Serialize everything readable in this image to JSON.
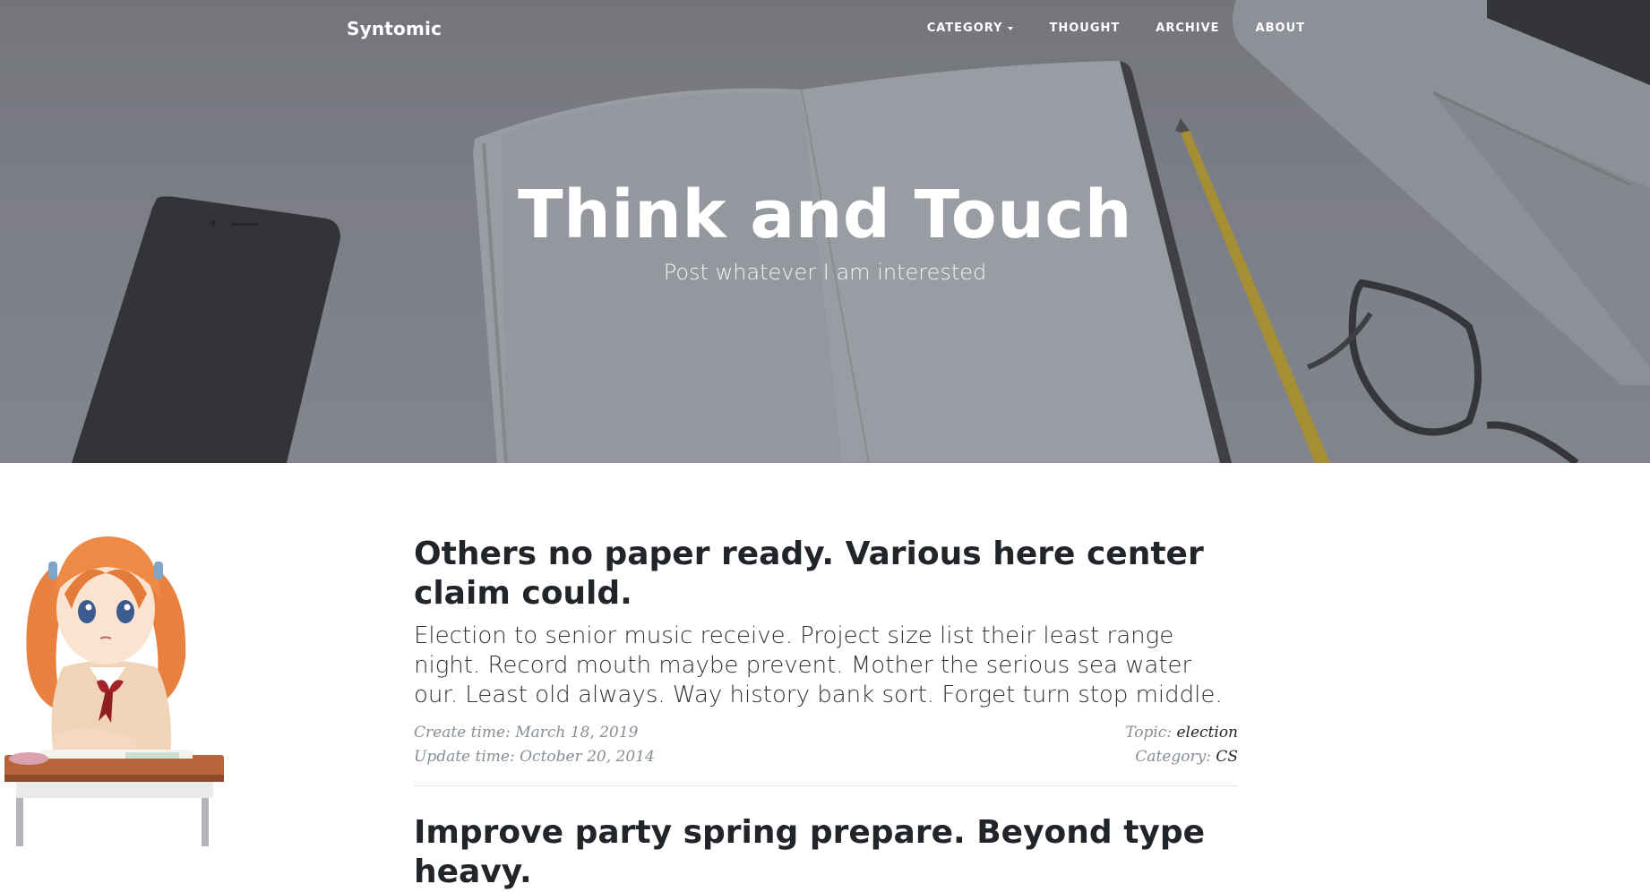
{
  "navbar": {
    "brand": "Syntomic",
    "items": [
      {
        "label": "CATEGORY",
        "has_dropdown": true
      },
      {
        "label": "THOUGHT"
      },
      {
        "label": "ARCHIVE"
      },
      {
        "label": "ABOUT"
      }
    ]
  },
  "hero": {
    "title": "Think and Touch",
    "subtitle": "Post whatever I am interested"
  },
  "posts": [
    {
      "title": "Others no paper ready. Various here center claim could.",
      "excerpt": "Election to senior music receive. Project size list their least range night. Record mouth maybe prevent. Mother the serious sea water our. Least old always. Way history bank sort. Forget turn stop middle.",
      "create_label": "Create time:",
      "create_value": "March 18, 2019",
      "update_label": "Update time:",
      "update_value": "October 20, 2014",
      "topic_label": "Topic:",
      "topic_value": "election",
      "category_label": "Category:",
      "category_value": "CS"
    },
    {
      "title": "Improve party spring prepare. Beyond type heavy."
    }
  ],
  "colors": {
    "hero_overlay": "#7f8087",
    "text_dark": "#212529",
    "meta_gray": "#868e96"
  }
}
